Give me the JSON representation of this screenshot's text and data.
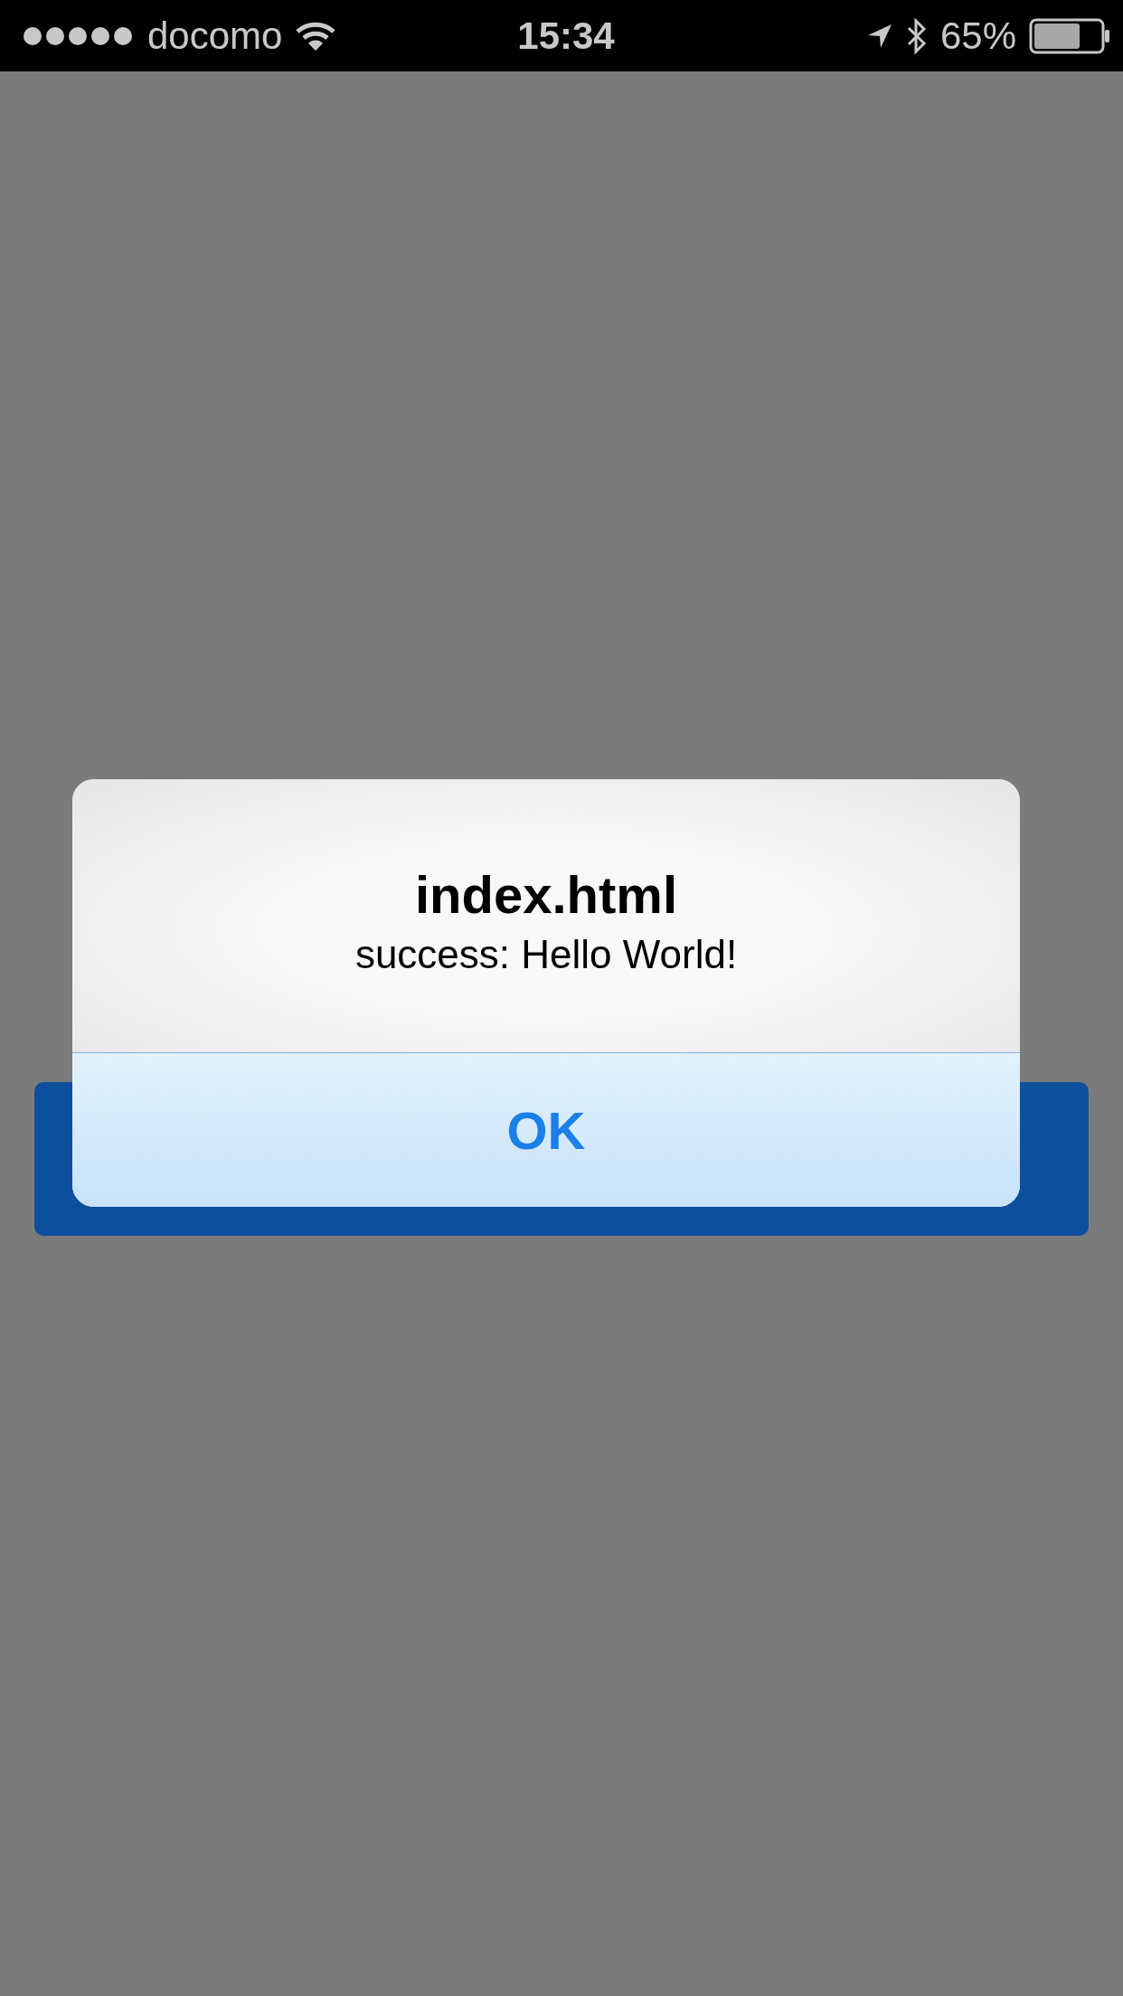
{
  "status_bar": {
    "carrier": "docomo",
    "time": "15:34",
    "battery": "65%"
  },
  "alert": {
    "title": "index.html",
    "message": "success: Hello World!",
    "buttons": [
      "OK"
    ]
  }
}
